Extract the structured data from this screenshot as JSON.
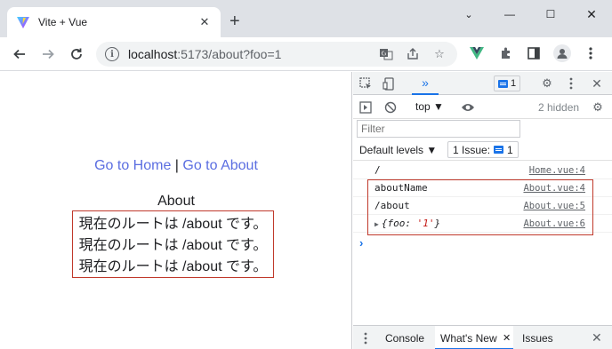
{
  "tab": {
    "title": "Vite + Vue",
    "close": "✕"
  },
  "window": {
    "chevron": "⌄",
    "minimize": "—",
    "maximize": "☐",
    "close": "✕"
  },
  "toolbar": {
    "url_host": "localhost",
    "url_rest": ":5173/about?foo=1"
  },
  "page": {
    "link_home": "Go to Home",
    "separator": " | ",
    "link_about": "Go to About",
    "about_title": "About",
    "route_lines": [
      "現在のルートは /about です。",
      "現在のルートは /about です。",
      "現在のルートは /about です。"
    ]
  },
  "devtools": {
    "more_tabs": "»",
    "message_count": "1",
    "context": "top ▼",
    "hidden": "2 hidden",
    "filter_placeholder": "Filter",
    "levels": "Default levels ▼",
    "issue_label": "1 Issue:",
    "issue_count": "1",
    "logs": [
      {
        "text": "/",
        "source": "Home.vue:4"
      },
      {
        "text": "aboutName",
        "source": "About.vue:4"
      },
      {
        "text": "/about",
        "source": "About.vue:5"
      },
      {
        "text": "",
        "source": "About.vue:6"
      }
    ],
    "obj_prefix": "{foo: ",
    "obj_value": "'1'",
    "obj_suffix": "}",
    "prompt": "›",
    "drawer": {
      "console": "Console",
      "whats_new": "What's New",
      "issues": "Issues"
    }
  },
  "colors": {
    "link": "#5b6ee1",
    "highlight_border": "#c0392b",
    "accent": "#1a73e8"
  }
}
